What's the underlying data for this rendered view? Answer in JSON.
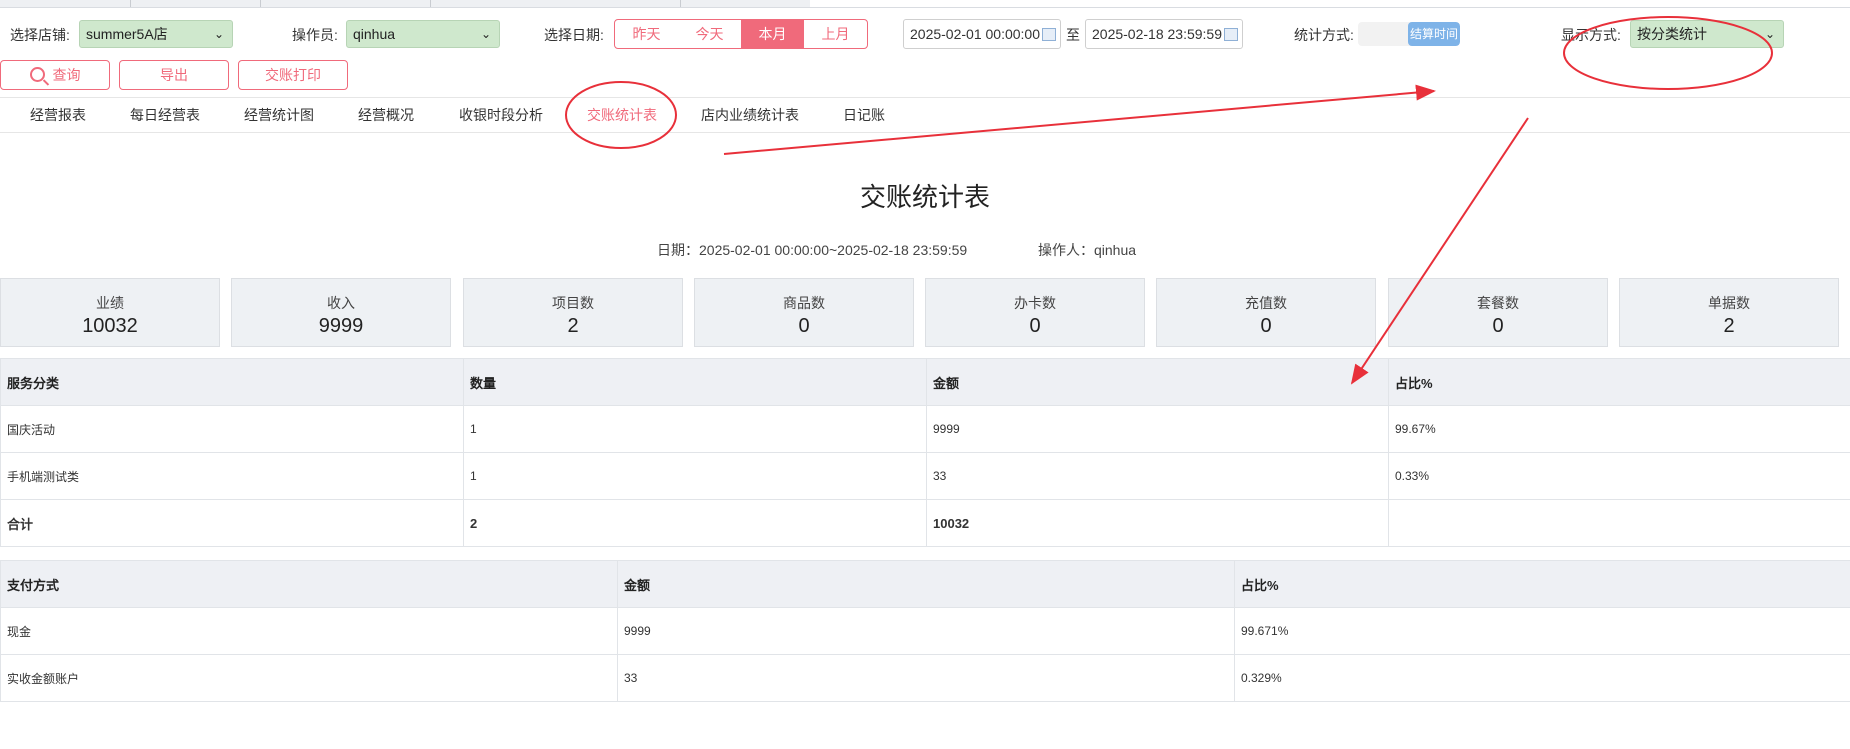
{
  "filters": {
    "store_label": "选择店铺:",
    "store_value": "summer5A店",
    "operator_label": "操作员:",
    "operator_value": "qinhua",
    "date_label": "选择日期:",
    "date_buttons": [
      "昨天",
      "今天",
      "本月",
      "上月"
    ],
    "date_active": "本月",
    "date_start": "2025-02-01 00:00:00",
    "date_sep": "至",
    "date_end": "2025-02-18 23:59:59",
    "stat_method_label": "统计方式:",
    "stat_method_value": "结算时间",
    "display_label": "显示方式:",
    "display_value": "按分类统计"
  },
  "actions": {
    "query": "查询",
    "export": "导出",
    "print": "交账打印"
  },
  "tabs": [
    "经营报表",
    "每日经营表",
    "经营统计图",
    "经营概况",
    "收银时段分析",
    "交账统计表",
    "店内业绩统计表",
    "日记账"
  ],
  "active_tab": "交账统计表",
  "report": {
    "title": "交账统计表",
    "date_text": "日期：2025-02-01 00:00:00~2025-02-18 23:59:59",
    "operator_text": "操作人：qinhua"
  },
  "summary": [
    {
      "label": "业绩",
      "value": "10032"
    },
    {
      "label": "收入",
      "value": "9999"
    },
    {
      "label": "项目数",
      "value": "2"
    },
    {
      "label": "商品数",
      "value": "0"
    },
    {
      "label": "办卡数",
      "value": "0"
    },
    {
      "label": "充值数",
      "value": "0"
    },
    {
      "label": "套餐数",
      "value": "0"
    },
    {
      "label": "单据数",
      "value": "2"
    }
  ],
  "service_table": {
    "headers": [
      "服务分类",
      "数量",
      "金额",
      "占比%"
    ],
    "rows": [
      [
        "国庆活动",
        "1",
        "9999",
        "99.67%"
      ],
      [
        "手机端测试类",
        "1",
        "33",
        "0.33%"
      ]
    ],
    "total": [
      "合计",
      "2",
      "10032",
      ""
    ]
  },
  "payment_table": {
    "headers": [
      "支付方式",
      "金额",
      "占比%"
    ],
    "rows": [
      [
        "现金",
        "9999",
        "99.671%"
      ],
      [
        "实收金额账户",
        "33",
        "0.329%"
      ]
    ]
  },
  "colors": {
    "accent": "#f06a7b",
    "select_bg": "#cfe8cd",
    "annotation": "#e8303a",
    "toggle_on": "#7eb3e8"
  }
}
